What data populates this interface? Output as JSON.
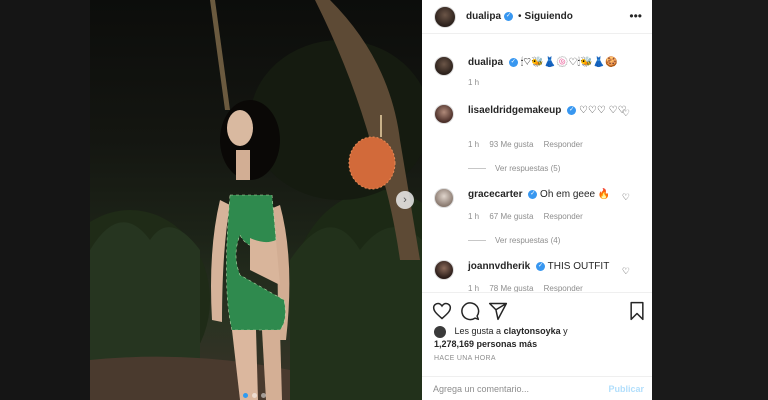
{
  "post": {
    "username": "dualipa",
    "separator": "•",
    "following_label": "Siguiendo",
    "caption": "🕯♡🐝👗🍥♡🕯🐝👗🍪",
    "caption_time": "1 h"
  },
  "comments": [
    {
      "username": "lisaeldridgemakeup",
      "text": "♡♡♡ ♡♡",
      "time": "1 h",
      "likes": "93 Me gusta",
      "reply": "Responder",
      "view_replies": "Ver respuestas (5)"
    },
    {
      "username": "gracecarter",
      "text": "Oh em geee 🔥",
      "time": "1 h",
      "likes": "67 Me gusta",
      "reply": "Responder",
      "view_replies": "Ver respuestas (4)"
    },
    {
      "username": "joannvdherik",
      "text": "THIS OUTFIT",
      "time": "1 h",
      "likes": "78 Me gusta",
      "reply": "Responder"
    }
  ],
  "likes": {
    "prefix": "Les gusta a",
    "user": "claytonsoyka",
    "connector": "y",
    "count": "1,278,169 personas más"
  },
  "time_ago": "HACE UNA HORA",
  "comment_box": {
    "placeholder": "Agrega un comentario...",
    "publish_label": "Publicar"
  },
  "icons": {
    "more": "more-options-icon",
    "like": "heart-icon",
    "comment": "comment-icon",
    "share": "share-icon",
    "save": "bookmark-icon",
    "next": "chevron-right-icon"
  },
  "colors": {
    "verified": "#3897f0",
    "publish": "#b2dffc",
    "active_dot": "#2f9bf0"
  }
}
